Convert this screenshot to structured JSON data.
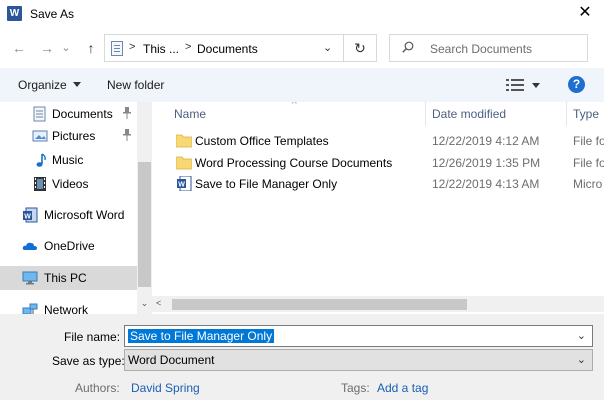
{
  "window": {
    "title": "Save As",
    "app_icon_letter": "W",
    "close_glyph": "✕"
  },
  "nav": {
    "back_glyph": "←",
    "forward_glyph": "→",
    "recent_glyph": "⌄",
    "up_glyph": "↑",
    "address_segments": [
      "This ...",
      "Documents"
    ],
    "address_separator": ">",
    "address_dropdown_glyph": "⌄",
    "refresh_glyph": "↻",
    "search_placeholder": "Search Documents"
  },
  "toolbar": {
    "organize_label": "Organize",
    "new_folder_label": "New folder",
    "help_glyph": "?"
  },
  "sidebar": {
    "items": [
      {
        "label": "Documents",
        "icon": "documents-icon",
        "pinned": true
      },
      {
        "label": "Pictures",
        "icon": "pictures-icon",
        "pinned": true
      },
      {
        "label": "Music",
        "icon": "music-icon",
        "pinned": false
      },
      {
        "label": "Videos",
        "icon": "videos-icon",
        "pinned": false
      },
      {
        "label": "Microsoft Word",
        "icon": "word-icon",
        "pinned": false
      },
      {
        "label": "OneDrive",
        "icon": "onedrive-icon",
        "pinned": false
      },
      {
        "label": "This PC",
        "icon": "this-pc-icon",
        "pinned": false,
        "selected": true
      },
      {
        "label": "Network",
        "icon": "network-icon",
        "pinned": false
      }
    ],
    "pin_glyph": "📌",
    "scroll_down_glyph": "⌄"
  },
  "file_list": {
    "columns": [
      "Name",
      "Date modified",
      "Type"
    ],
    "sort_glyph": "^",
    "rows": [
      {
        "name": "Custom Office Templates",
        "date": "12/22/2019 4:12 AM",
        "type": "File fo",
        "icon": "folder-icon"
      },
      {
        "name": "Word Processing Course Documents",
        "date": "12/26/2019 1:35 PM",
        "type": "File fo",
        "icon": "folder-icon"
      },
      {
        "name": "Save to File Manager Only",
        "date": "12/22/2019 4:13 AM",
        "type": "Micro",
        "icon": "word-document-icon"
      }
    ],
    "hscroll_left_glyph": "<"
  },
  "form": {
    "file_name_label": "File name:",
    "file_name_value": "Save to File Manager Only",
    "save_as_type_label": "Save as type:",
    "save_as_type_value": "Word Document",
    "dropdown_glyph": "⌄",
    "authors_label": "Authors:",
    "authors_value": "David Spring",
    "tags_label": "Tags:",
    "tags_value": "Add a tag"
  },
  "colors": {
    "accent": "#1e6fd1",
    "selection": "#0078d7",
    "folder": "#f8d775",
    "toolbar_bg": "#f0f5fb"
  }
}
